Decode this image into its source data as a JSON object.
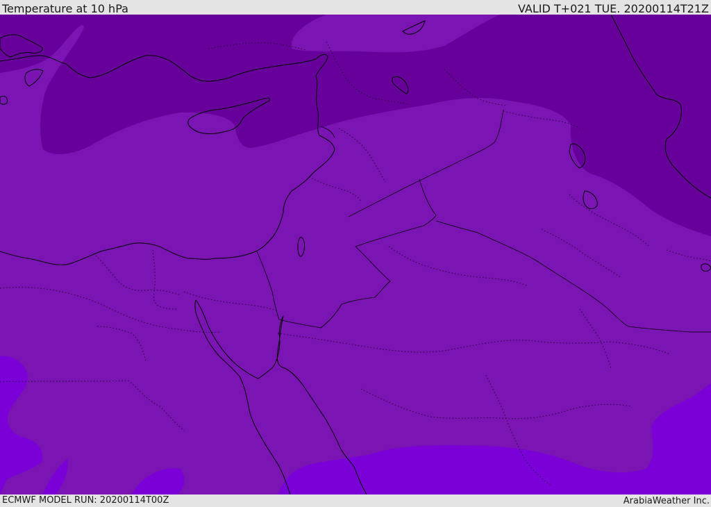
{
  "header": {
    "title": "Temperature at 10 hPa",
    "valid_time": "VALID T+021 TUE. 20200114T21Z"
  },
  "footer": {
    "model_run": "ECMWF MODEL RUN: 20200114T00Z",
    "credit": "ArabiaWeather Inc."
  },
  "map": {
    "region": "Eastern Mediterranean / Middle East",
    "colors": {
      "dark_purple": "#67009a",
      "mid_purple": "#7a14b2",
      "violet": "#7b00d8",
      "coastline": "#000000"
    }
  }
}
